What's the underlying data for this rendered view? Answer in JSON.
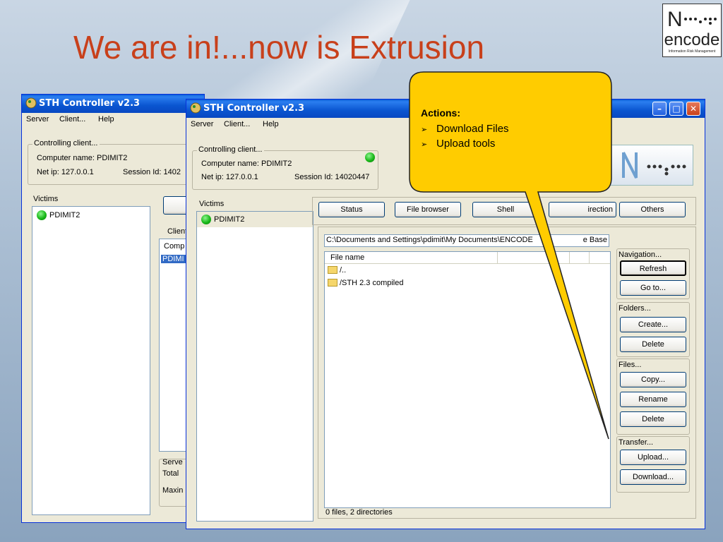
{
  "slide": {
    "title": "We are in!...now is Extrusion",
    "logo": {
      "word": "encode",
      "sub": "Information Risk Management"
    }
  },
  "back_window": {
    "title": "STH Controller v2.3",
    "menu": [
      "Server",
      "Client...",
      "Help"
    ],
    "controlling": {
      "legend": "Controlling client...",
      "computer_name": "Computer name: PDIMIT2",
      "net_ip": "Net ip: 127.0.0.1",
      "session": "Session Id: 1402"
    },
    "victims_label": "Victims",
    "victim": "PDIMIT2",
    "clients_label": "Clients:",
    "comp_header": "Comp",
    "comp_row": "PDIMI",
    "server_label": "Serve",
    "total_label": "Total",
    "max_label": "Maxin"
  },
  "front_window": {
    "title": "STH Controller v2.3",
    "menu": [
      "Server",
      "Client...",
      "Help"
    ],
    "controlling": {
      "legend": "Controlling client...",
      "computer_name": "Computer name: PDIMIT2",
      "net_ip": "Net ip: 127.0.0.1",
      "session": "Session Id: 14020447"
    },
    "victims_label": "Victims",
    "victim": "PDIMIT2",
    "tabs": [
      "Status",
      "File browser",
      "Shell",
      "irection",
      "Others"
    ],
    "path": "C:\\Documents and Settings\\pdimit\\My Documents\\ENCODE",
    "path_tail": "e Base",
    "column_header": "File name",
    "files": [
      "/..",
      "/STH 2.3 compiled"
    ],
    "status": "0 files, 2 directories",
    "navigation": {
      "legend": "Navigation...",
      "buttons": [
        "Refresh",
        "Go to..."
      ]
    },
    "folders": {
      "legend": "Folders...",
      "buttons": [
        "Create...",
        "Delete"
      ]
    },
    "files_group": {
      "legend": "Files...",
      "buttons": [
        "Copy...",
        "Rename",
        "Delete"
      ]
    },
    "transfer": {
      "legend": "Transfer...",
      "buttons": [
        "Upload...",
        "Download..."
      ]
    }
  },
  "callout": {
    "heading": "Actions:",
    "items": [
      "Download Files",
      "Upload tools"
    ],
    "color": "#ffcc00"
  },
  "colors": {
    "title": "#c8401b",
    "titlebar": "#0a55d0",
    "window_bg": "#ece9d8"
  }
}
